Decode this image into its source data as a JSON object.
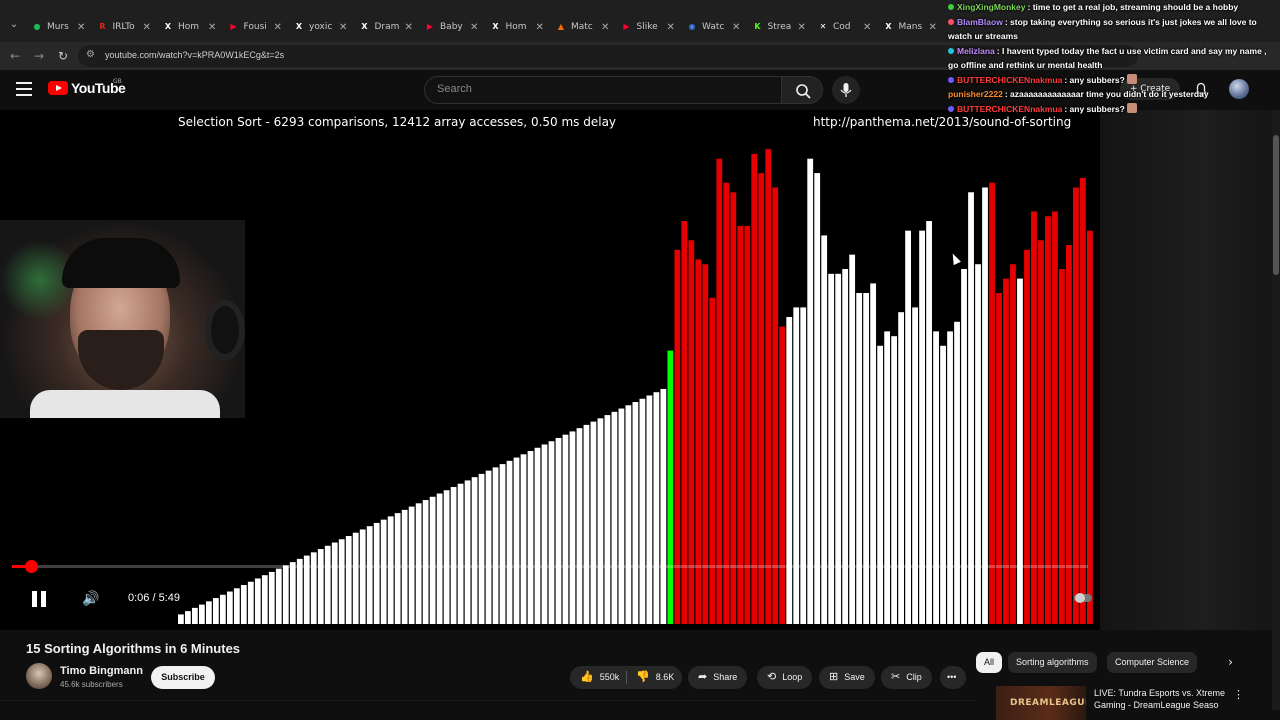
{
  "browser": {
    "tabs": [
      {
        "label": "Murs",
        "color": "#1db954",
        "glyph": "●"
      },
      {
        "label": "IRLTo",
        "color": "#e02424",
        "glyph": "R"
      },
      {
        "label": "Hom",
        "color": "#ffffff",
        "glyph": "X"
      },
      {
        "label": "Fousi",
        "color": "#ff0033",
        "glyph": "▶"
      },
      {
        "label": "yoxic",
        "color": "#ffffff",
        "glyph": "X"
      },
      {
        "label": "Dram",
        "color": "#ffffff",
        "glyph": "X"
      },
      {
        "label": "Baby",
        "color": "#ff0033",
        "glyph": "▶"
      },
      {
        "label": "Hom",
        "color": "#ffffff",
        "glyph": "X"
      },
      {
        "label": "Matc",
        "color": "#ff6a00",
        "glyph": "▲"
      },
      {
        "label": "Slike",
        "color": "#ff0033",
        "glyph": "▶"
      },
      {
        "label": "Watc",
        "color": "#3d8bff",
        "glyph": "◉"
      },
      {
        "label": "Strea",
        "color": "#53fc18",
        "glyph": "K"
      },
      {
        "label": "Cod",
        "color": "#ffffff",
        "glyph": "✕"
      },
      {
        "label": "Mans",
        "color": "#ffffff",
        "glyph": "X"
      }
    ],
    "url": "youtube.com/watch?v=kPRA0W1kECg&t=2s"
  },
  "youtube": {
    "logo_text": "YouTube",
    "region": "GB",
    "search_placeholder": "Search",
    "create_label": "Create"
  },
  "video": {
    "viz_title": "Selection Sort - 6293 comparisons, 12412 array accesses, 0.50 ms delay",
    "viz_url": "http://panthema.net/2013/sound-of-sorting",
    "time_display": "0:06 / 5:49",
    "progress_fraction": 0.018,
    "title": "15 Sorting Algorithms in 6 Minutes",
    "channel_name": "Timo Bingmann",
    "subscribers": "45.6k subscribers",
    "subscribe_label": "Subscribe",
    "likes": "550k",
    "dislikes": "8.6K",
    "share_label": "Share",
    "loop_label": "Loop",
    "save_label": "Save",
    "clip_label": "Clip",
    "hd_badge": "HD"
  },
  "chips": [
    "All",
    "Sorting algorithms",
    "Computer Science"
  ],
  "recommendation": {
    "thumb_text": "DREAMLEAGUE",
    "title": "LIVE: Tundra Esports vs. Xtreme Gaming - DreamLeague Seaso"
  },
  "chat": [
    {
      "user": "XingXingMonkey",
      "color": "#7ed957",
      "dot": "#3ecf3e",
      "msg": "time to get a real job, streaming should be a hobby",
      "emote": false
    },
    {
      "user": "BlamBlaow",
      "color": "#b48cff",
      "dot": "#ff4d6a",
      "msg": "stop taking everything so serious it's just jokes we all love to watch ur streams",
      "emote": false
    },
    {
      "user": "Melizlana",
      "color": "#c38bff",
      "dot": "#23c5d8",
      "msg": "I havent typed today the fact u use victim card and say my name , go offline and rethink ur mental health",
      "emote": false
    },
    {
      "user": "BUTTERCHICKENnakmua",
      "color": "#ff3b3b",
      "dot": "#6f5cff",
      "msg": "any subbers?",
      "emote": true
    },
    {
      "user": "punisher2222",
      "color": "#ff8c2a",
      "dot": "",
      "msg": "azaaaaaaaaaaaaar time you didn't do it yesterday",
      "emote": false
    },
    {
      "user": "BUTTERCHICKENnakmua",
      "color": "#ff3b3b",
      "dot": "#6f5cff",
      "msg": "any subbers?",
      "emote": true
    }
  ],
  "colors": {
    "bar_sorted": "#ffffff",
    "bar_unsorted": "#e60000",
    "bar_current": "#00ff00",
    "accent": "#ff0000"
  },
  "chart_data": {
    "type": "bar",
    "title": "Selection Sort - 6293 comparisons, 12412 array accesses, 0.50 ms delay",
    "sorted_count": 70,
    "current_index": 70,
    "total": 131,
    "sorted_max_value": 0.49,
    "remaining_values": [
      0.57,
      0.78,
      0.84,
      0.8,
      0.76,
      0.75,
      0.68,
      0.97,
      0.92,
      0.9,
      0.83,
      0.83,
      0.98,
      0.94,
      0.99,
      0.91,
      0.62,
      0.64,
      0.66,
      0.66,
      0.97,
      0.94,
      0.81,
      0.73,
      0.73,
      0.74,
      0.77,
      0.69,
      0.69,
      0.71,
      0.58,
      0.61,
      0.6,
      0.65,
      0.82,
      0.66,
      0.82,
      0.84,
      0.61,
      0.58,
      0.61,
      0.63,
      0.74,
      0.9,
      0.75,
      0.91,
      0.92,
      0.69,
      0.72,
      0.75,
      0.72,
      0.78,
      0.86,
      0.8,
      0.85,
      0.86,
      0.74,
      0.79,
      0.91,
      0.93,
      0.82
    ],
    "white_in_remaining": [
      17,
      18,
      19,
      20,
      21,
      22,
      23,
      24,
      25,
      26,
      27,
      28,
      29,
      30,
      31,
      32,
      33,
      34,
      35,
      36,
      37,
      38,
      39,
      40,
      41,
      42,
      43,
      44,
      45,
      50
    ]
  }
}
